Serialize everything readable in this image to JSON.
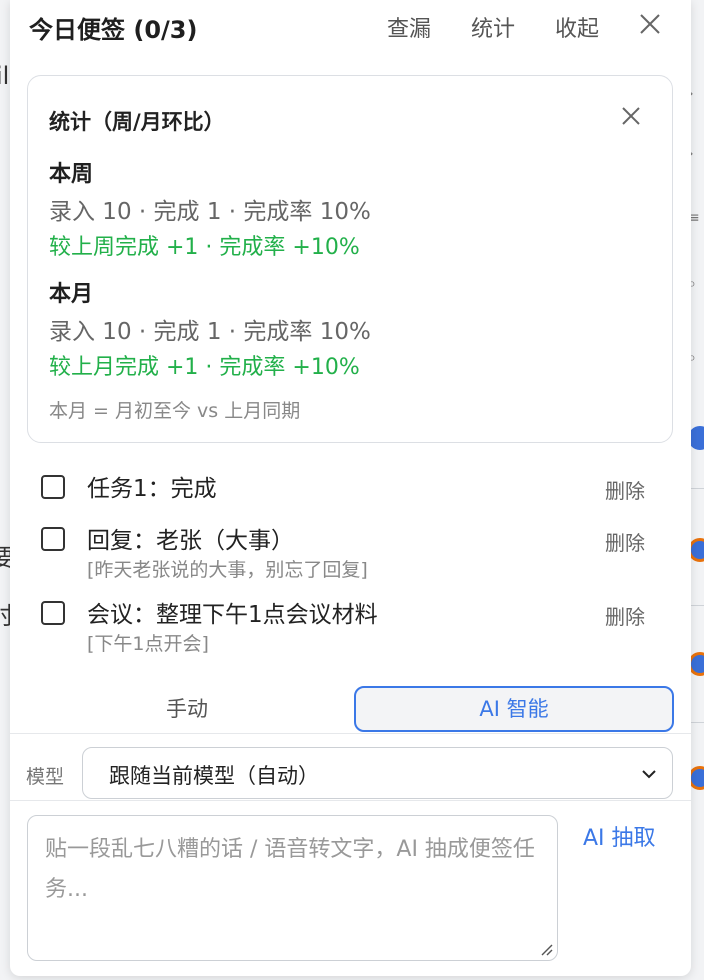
{
  "background": {
    "fragments": [
      "ill",
      "要",
      "时"
    ]
  },
  "header": {
    "title": "今日便签 (0/3)",
    "btn_check": "查漏",
    "btn_stats": "统计",
    "btn_collapse": "收起"
  },
  "stats": {
    "title": "统计（周/月环比）",
    "week": {
      "heading": "本周",
      "line": "录入 10 · 完成 1 · 完成率 10%",
      "compare": "较上周完成 +1 · 完成率 +10%"
    },
    "month": {
      "heading": "本月",
      "line": "录入 10 · 完成 1 · 完成率 10%",
      "compare": "较上月完成 +1 · 完成率 +10%"
    },
    "note": "本月 = 月初至今 vs 上月同期"
  },
  "tasks": [
    {
      "title": "任务1：完成",
      "note": "",
      "delete_label": "删除"
    },
    {
      "title": "回复：老张（大事）",
      "note": "[昨天老张说的大事，别忘了回复]",
      "delete_label": "删除"
    },
    {
      "title": "会议：整理下午1点会议材料",
      "note": "[下午1点开会]",
      "delete_label": "删除"
    }
  ],
  "mode": {
    "manual": "手动",
    "ai": "AI 智能",
    "selected": "AI 智能"
  },
  "model": {
    "label": "模型",
    "selected": "跟随当前模型（自动）"
  },
  "input": {
    "placeholder": "贴一段乱七八糟的话 / 语音转文字，AI 抽成便签任务..."
  },
  "actions": {
    "extract": "AI 抽取"
  },
  "colors": {
    "accent": "#3b78e7",
    "positive": "#22b04a"
  }
}
